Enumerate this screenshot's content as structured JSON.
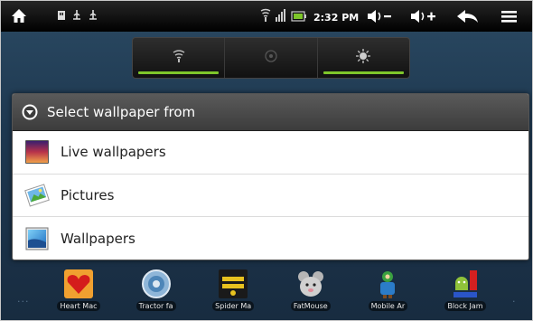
{
  "status_bar": {
    "time": "2:32 PM",
    "icons": [
      "home-icon",
      "usb-icon",
      "usb-debug-icon",
      "usb-debug-icon",
      "wifi-icon",
      "signal-icon",
      "battery-icon",
      "volume-down-icon",
      "volume-up-icon",
      "back-icon",
      "menu-icon"
    ]
  },
  "power_widget": {
    "toggles": [
      "wifi-toggle",
      "gps-toggle",
      "brightness-toggle"
    ],
    "active_color": "#7ec62a"
  },
  "dialog": {
    "title": "Select wallpaper from",
    "items": [
      {
        "label": "Live wallpapers",
        "icon": "live-wallpaper-icon"
      },
      {
        "label": "Pictures",
        "icon": "pictures-icon"
      },
      {
        "label": "Wallpapers",
        "icon": "wallpapers-icon"
      }
    ]
  },
  "dock": {
    "apps": [
      {
        "label": "Heart Mac",
        "icon": "heart-app-icon"
      },
      {
        "label": "Tractor fa",
        "icon": "tractor-app-icon"
      },
      {
        "label": "Spider Ma",
        "icon": "spider-app-icon"
      },
      {
        "label": "FatMouse",
        "icon": "mouse-app-icon"
      },
      {
        "label": "Mobile Ar",
        "icon": "mobile-app-icon"
      },
      {
        "label": "Block Jam",
        "icon": "block-app-icon"
      }
    ]
  }
}
